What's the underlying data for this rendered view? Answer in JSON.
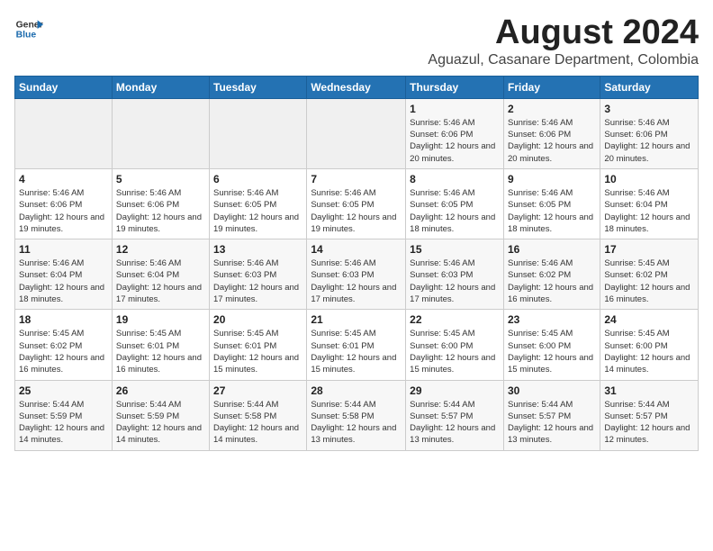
{
  "header": {
    "logo_general": "General",
    "logo_blue": "Blue",
    "month_title": "August 2024",
    "location": "Aguazul, Casanare Department, Colombia"
  },
  "weekdays": [
    "Sunday",
    "Monday",
    "Tuesday",
    "Wednesday",
    "Thursday",
    "Friday",
    "Saturday"
  ],
  "weeks": [
    [
      {
        "day": "",
        "sunrise": "",
        "sunset": "",
        "daylight": "",
        "empty": true
      },
      {
        "day": "",
        "sunrise": "",
        "sunset": "",
        "daylight": "",
        "empty": true
      },
      {
        "day": "",
        "sunrise": "",
        "sunset": "",
        "daylight": "",
        "empty": true
      },
      {
        "day": "",
        "sunrise": "",
        "sunset": "",
        "daylight": "",
        "empty": true
      },
      {
        "day": "1",
        "sunrise": "Sunrise: 5:46 AM",
        "sunset": "Sunset: 6:06 PM",
        "daylight": "Daylight: 12 hours and 20 minutes.",
        "empty": false
      },
      {
        "day": "2",
        "sunrise": "Sunrise: 5:46 AM",
        "sunset": "Sunset: 6:06 PM",
        "daylight": "Daylight: 12 hours and 20 minutes.",
        "empty": false
      },
      {
        "day": "3",
        "sunrise": "Sunrise: 5:46 AM",
        "sunset": "Sunset: 6:06 PM",
        "daylight": "Daylight: 12 hours and 20 minutes.",
        "empty": false
      }
    ],
    [
      {
        "day": "4",
        "sunrise": "Sunrise: 5:46 AM",
        "sunset": "Sunset: 6:06 PM",
        "daylight": "Daylight: 12 hours and 19 minutes.",
        "empty": false
      },
      {
        "day": "5",
        "sunrise": "Sunrise: 5:46 AM",
        "sunset": "Sunset: 6:06 PM",
        "daylight": "Daylight: 12 hours and 19 minutes.",
        "empty": false
      },
      {
        "day": "6",
        "sunrise": "Sunrise: 5:46 AM",
        "sunset": "Sunset: 6:05 PM",
        "daylight": "Daylight: 12 hours and 19 minutes.",
        "empty": false
      },
      {
        "day": "7",
        "sunrise": "Sunrise: 5:46 AM",
        "sunset": "Sunset: 6:05 PM",
        "daylight": "Daylight: 12 hours and 19 minutes.",
        "empty": false
      },
      {
        "day": "8",
        "sunrise": "Sunrise: 5:46 AM",
        "sunset": "Sunset: 6:05 PM",
        "daylight": "Daylight: 12 hours and 18 minutes.",
        "empty": false
      },
      {
        "day": "9",
        "sunrise": "Sunrise: 5:46 AM",
        "sunset": "Sunset: 6:05 PM",
        "daylight": "Daylight: 12 hours and 18 minutes.",
        "empty": false
      },
      {
        "day": "10",
        "sunrise": "Sunrise: 5:46 AM",
        "sunset": "Sunset: 6:04 PM",
        "daylight": "Daylight: 12 hours and 18 minutes.",
        "empty": false
      }
    ],
    [
      {
        "day": "11",
        "sunrise": "Sunrise: 5:46 AM",
        "sunset": "Sunset: 6:04 PM",
        "daylight": "Daylight: 12 hours and 18 minutes.",
        "empty": false
      },
      {
        "day": "12",
        "sunrise": "Sunrise: 5:46 AM",
        "sunset": "Sunset: 6:04 PM",
        "daylight": "Daylight: 12 hours and 17 minutes.",
        "empty": false
      },
      {
        "day": "13",
        "sunrise": "Sunrise: 5:46 AM",
        "sunset": "Sunset: 6:03 PM",
        "daylight": "Daylight: 12 hours and 17 minutes.",
        "empty": false
      },
      {
        "day": "14",
        "sunrise": "Sunrise: 5:46 AM",
        "sunset": "Sunset: 6:03 PM",
        "daylight": "Daylight: 12 hours and 17 minutes.",
        "empty": false
      },
      {
        "day": "15",
        "sunrise": "Sunrise: 5:46 AM",
        "sunset": "Sunset: 6:03 PM",
        "daylight": "Daylight: 12 hours and 17 minutes.",
        "empty": false
      },
      {
        "day": "16",
        "sunrise": "Sunrise: 5:46 AM",
        "sunset": "Sunset: 6:02 PM",
        "daylight": "Daylight: 12 hours and 16 minutes.",
        "empty": false
      },
      {
        "day": "17",
        "sunrise": "Sunrise: 5:45 AM",
        "sunset": "Sunset: 6:02 PM",
        "daylight": "Daylight: 12 hours and 16 minutes.",
        "empty": false
      }
    ],
    [
      {
        "day": "18",
        "sunrise": "Sunrise: 5:45 AM",
        "sunset": "Sunset: 6:02 PM",
        "daylight": "Daylight: 12 hours and 16 minutes.",
        "empty": false
      },
      {
        "day": "19",
        "sunrise": "Sunrise: 5:45 AM",
        "sunset": "Sunset: 6:01 PM",
        "daylight": "Daylight: 12 hours and 16 minutes.",
        "empty": false
      },
      {
        "day": "20",
        "sunrise": "Sunrise: 5:45 AM",
        "sunset": "Sunset: 6:01 PM",
        "daylight": "Daylight: 12 hours and 15 minutes.",
        "empty": false
      },
      {
        "day": "21",
        "sunrise": "Sunrise: 5:45 AM",
        "sunset": "Sunset: 6:01 PM",
        "daylight": "Daylight: 12 hours and 15 minutes.",
        "empty": false
      },
      {
        "day": "22",
        "sunrise": "Sunrise: 5:45 AM",
        "sunset": "Sunset: 6:00 PM",
        "daylight": "Daylight: 12 hours and 15 minutes.",
        "empty": false
      },
      {
        "day": "23",
        "sunrise": "Sunrise: 5:45 AM",
        "sunset": "Sunset: 6:00 PM",
        "daylight": "Daylight: 12 hours and 15 minutes.",
        "empty": false
      },
      {
        "day": "24",
        "sunrise": "Sunrise: 5:45 AM",
        "sunset": "Sunset: 6:00 PM",
        "daylight": "Daylight: 12 hours and 14 minutes.",
        "empty": false
      }
    ],
    [
      {
        "day": "25",
        "sunrise": "Sunrise: 5:44 AM",
        "sunset": "Sunset: 5:59 PM",
        "daylight": "Daylight: 12 hours and 14 minutes.",
        "empty": false
      },
      {
        "day": "26",
        "sunrise": "Sunrise: 5:44 AM",
        "sunset": "Sunset: 5:59 PM",
        "daylight": "Daylight: 12 hours and 14 minutes.",
        "empty": false
      },
      {
        "day": "27",
        "sunrise": "Sunrise: 5:44 AM",
        "sunset": "Sunset: 5:58 PM",
        "daylight": "Daylight: 12 hours and 14 minutes.",
        "empty": false
      },
      {
        "day": "28",
        "sunrise": "Sunrise: 5:44 AM",
        "sunset": "Sunset: 5:58 PM",
        "daylight": "Daylight: 12 hours and 13 minutes.",
        "empty": false
      },
      {
        "day": "29",
        "sunrise": "Sunrise: 5:44 AM",
        "sunset": "Sunset: 5:57 PM",
        "daylight": "Daylight: 12 hours and 13 minutes.",
        "empty": false
      },
      {
        "day": "30",
        "sunrise": "Sunrise: 5:44 AM",
        "sunset": "Sunset: 5:57 PM",
        "daylight": "Daylight: 12 hours and 13 minutes.",
        "empty": false
      },
      {
        "day": "31",
        "sunrise": "Sunrise: 5:44 AM",
        "sunset": "Sunset: 5:57 PM",
        "daylight": "Daylight: 12 hours and 12 minutes.",
        "empty": false
      }
    ]
  ]
}
